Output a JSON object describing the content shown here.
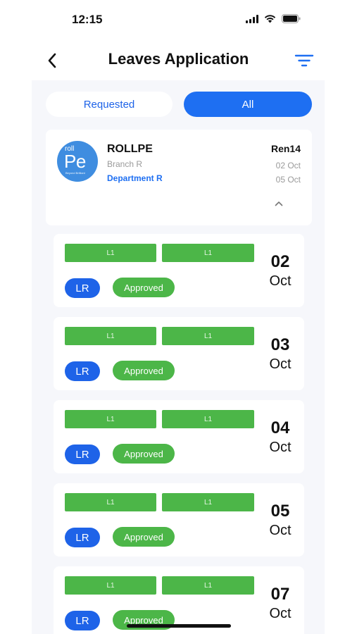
{
  "status_bar": {
    "time": "12:15"
  },
  "header": {
    "title": "Leaves Application"
  },
  "tabs": [
    {
      "label": "Requested",
      "active": false
    },
    {
      "label": "All",
      "active": true
    }
  ],
  "employee": {
    "avatar_small": "roll",
    "avatar_big": "Pe",
    "avatar_tag": "Beyond Brilliant",
    "name": "ROLLPE",
    "branch": "Branch R",
    "department": "Department R",
    "code": "Ren14",
    "from_date": "02 Oct",
    "to_date": "05 Oct"
  },
  "leaves": [
    {
      "levels": [
        "L1",
        "L1"
      ],
      "type": "LR",
      "status": "Approved",
      "day": "02",
      "month": "Oct"
    },
    {
      "levels": [
        "L1",
        "L1"
      ],
      "type": "LR",
      "status": "Approved",
      "day": "03",
      "month": "Oct"
    },
    {
      "levels": [
        "L1",
        "L1"
      ],
      "type": "LR",
      "status": "Approved",
      "day": "04",
      "month": "Oct"
    },
    {
      "levels": [
        "L1",
        "L1"
      ],
      "type": "LR",
      "status": "Approved",
      "day": "05",
      "month": "Oct"
    },
    {
      "levels": [
        "L1",
        "L1"
      ],
      "type": "LR",
      "status": "Approved",
      "day": "07",
      "month": "Oct"
    }
  ],
  "colors": {
    "primary": "#1e6ff2",
    "approved": "#4cb648",
    "panel_bg": "#f6f7fb"
  }
}
